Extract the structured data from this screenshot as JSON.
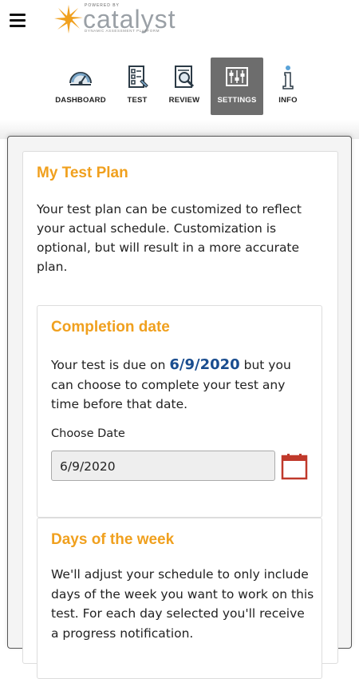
{
  "header": {
    "menu_icon": "hamburger-icon",
    "logo": {
      "powered_by": "POWERED BY",
      "brand": "catalyst",
      "tagline": "DYNAMIC ASSESSMENT PLATFORM"
    }
  },
  "nav": {
    "items": [
      {
        "label": "DASHBOARD",
        "icon": "gauge-icon",
        "active": false
      },
      {
        "label": "TEST",
        "icon": "test-sheet-icon",
        "active": false
      },
      {
        "label": "REVIEW",
        "icon": "magnifier-doc-icon",
        "active": false
      },
      {
        "label": "SETTINGS",
        "icon": "sliders-icon",
        "active": true
      },
      {
        "label": "INFO",
        "icon": "info-icon",
        "active": false
      }
    ]
  },
  "plan": {
    "title": "My Test Plan",
    "description": "Your test plan can be customized to reflect your actual schedule. Customization is optional, but will result in a more accurate plan."
  },
  "completion": {
    "title": "Completion date",
    "text_before": "Your test is due on ",
    "due_date": "6/9/2020",
    "text_after": " but you can choose to complete your test any time before that date.",
    "choose_label": "Choose Date",
    "date_value": "6/9/2020",
    "calendar_icon": "calendar-icon"
  },
  "days": {
    "title": "Days of the week",
    "text": "We'll adjust your schedule to only include days of the week you want to work on this test. For each day selected you'll receive a progress notification."
  },
  "colors": {
    "accent_orange": "#f0a01e",
    "due_blue": "#1a4d8f",
    "active_tab": "#6d6d6d",
    "calendar_red": "#c0392b"
  }
}
